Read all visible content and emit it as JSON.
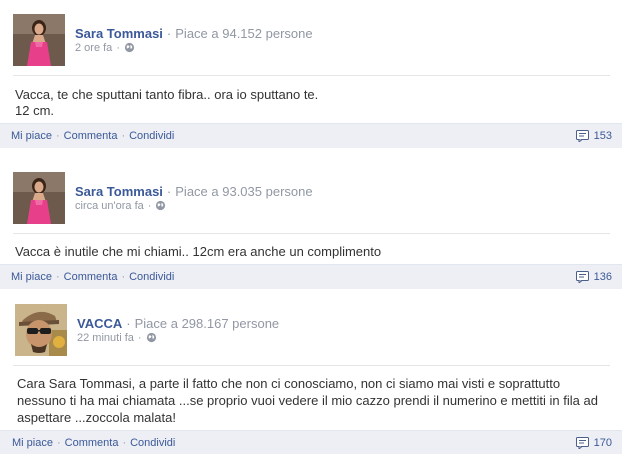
{
  "posts": [
    {
      "author": "Sara Tommasi",
      "separator": "·",
      "likes": "Piace a 94.152 persone",
      "time": "2 ore fa",
      "time_sep": "·",
      "avatar_icon": "profile-photo-woman-pink-dress",
      "text": "Vacca, te che sputtani tanto fibra.. ora io sputtano te.\n12 cm.",
      "actions": {
        "like": "Mi piace",
        "comment": "Commenta",
        "share": "Condividi",
        "sep": "·"
      },
      "comment_count": "153",
      "comment_icon": "comment-icon"
    },
    {
      "author": "Sara Tommasi",
      "separator": "·",
      "likes": "Piace a 93.035 persone",
      "time": "circa un'ora fa",
      "time_sep": "·",
      "avatar_icon": "profile-photo-woman-pink-dress",
      "text": "Vacca è inutile che mi chiami.. 12cm era anche un complimento",
      "actions": {
        "like": "Mi piace",
        "comment": "Commenta",
        "share": "Condividi",
        "sep": "·"
      },
      "comment_count": "136",
      "comment_icon": "comment-icon"
    },
    {
      "author": "VACCA",
      "separator": "·",
      "likes": "Piace a 298.167 persone",
      "time": "22 minuti fa",
      "time_sep": "·",
      "avatar_icon": "profile-photo-man-cap-sunglasses",
      "text": "Cara Sara Tommasi, a parte il fatto che non ci conosciamo, non ci siamo mai visti e soprattutto nessuno ti ha mai chiamata ...se proprio vuoi vedere il mio cazzo prendi il numerino e mettiti in fila ad aspettare ...zoccola malata!",
      "actions": {
        "like": "Mi piace",
        "comment": "Commenta",
        "share": "Condividi",
        "sep": "·"
      },
      "comment_count": "170",
      "comment_icon": "comment-icon"
    }
  ],
  "colors": {
    "link": "#3b5998",
    "meta": "#9197a3",
    "action_bar": "#edeff4",
    "dress_pink": "#e83f8a"
  }
}
